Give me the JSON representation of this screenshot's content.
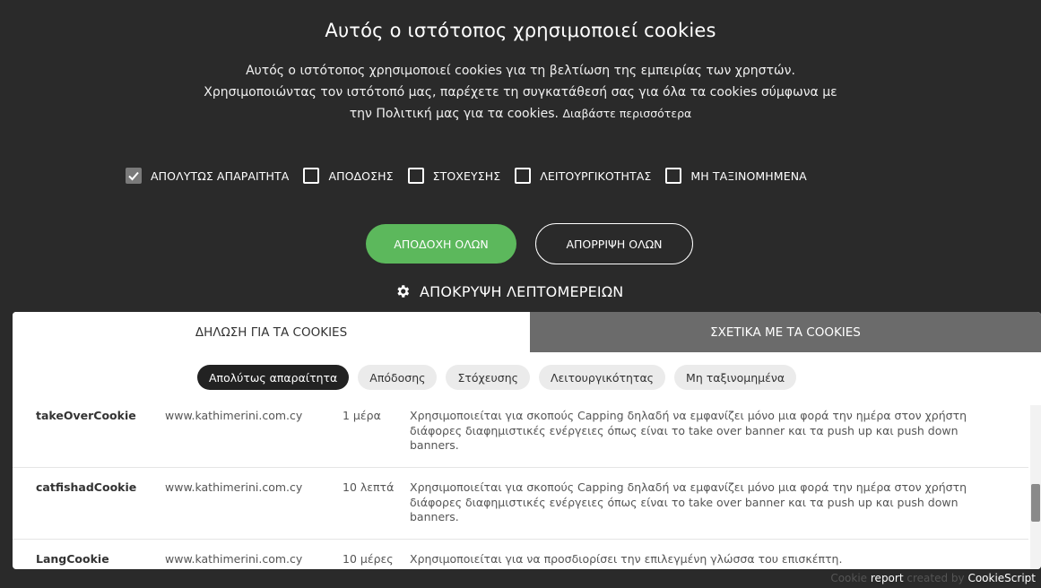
{
  "banner": {
    "title": "Αυτός ο ιστότοπος χρησιμοποιεί cookies",
    "desc_line1": "Αυτός ο ιστότοπος χρησιμοποιεί cookies για τη βελτίωση της εμπειρίας των χρηστών.",
    "desc_line2": "Χρησιμοποιώντας τον ιστότοπό μας, παρέχετε τη συγκατάθεσή σας για όλα τα cookies σύμφωνα με",
    "desc_line3": "την Πολιτική μας για τα cookies.",
    "read_more": "Διαβάστε περισσότερα"
  },
  "checkboxes": [
    {
      "label": "ΑΠΟΛΥΤΩΣ ΑΠΑΡΑΙΤΗΤΑ",
      "checked": true
    },
    {
      "label": "ΑΠΟΔΟΣΗΣ",
      "checked": false
    },
    {
      "label": "ΣΤΟΧΕΥΣΗΣ",
      "checked": false
    },
    {
      "label": "ΛΕΙΤΟΥΡΓΙΚΟΤΗΤΑΣ",
      "checked": false
    },
    {
      "label": "ΜΗ ΤΑΞΙΝΟΜΗΜΕΝΑ",
      "checked": false
    }
  ],
  "buttons": {
    "accept": "ΑΠΟΔΟΧΗ ΟΛΩΝ",
    "reject": "ΑΠΟΡΡΙΨΗ ΟΛΩΝ",
    "details_toggle": "ΑΠΟΚΡΥΨΗ ΛΕΠΤΟΜΕΡΕΙΩΝ"
  },
  "tabs": [
    {
      "label": "ΔΗΛΩΣΗ ΓΙΑ ΤΑ COOKIES",
      "active": true
    },
    {
      "label": "ΣΧΕΤΙΚΑ ΜΕ ΤΑ COOKIES",
      "active": false
    }
  ],
  "categories": [
    {
      "label": "Απολύτως απαραίτητα",
      "active": true
    },
    {
      "label": "Απόδοσης",
      "active": false
    },
    {
      "label": "Στόχευσης",
      "active": false
    },
    {
      "label": "Λειτουργικότητας",
      "active": false
    },
    {
      "label": "Μη ταξινομημένα",
      "active": false
    }
  ],
  "cookies": [
    {
      "name": "takeOverCookie",
      "host": "www.kathimerini.com.cy",
      "expiry": "1 μέρα",
      "description": "Χρησιμοποιείται για σκοπούς Capping δηλαδή να εμφανίζει μόνο μια φορά την ημέρα στον χρήστη διάφορες διαφημιστικές ενέργειες όπως είναι το take over banner και τα push up και push down banners."
    },
    {
      "name": "catfishadCookie",
      "host": "www.kathimerini.com.cy",
      "expiry": "10 λεπτά",
      "description": "Χρησιμοποιείται για σκοπούς Capping δηλαδή να εμφανίζει μόνο μια φορά την ημέρα στον χρήστη διάφορες διαφημιστικές ενέργειες όπως είναι το take over banner και τα push up και push down banners."
    },
    {
      "name": "LangCookie",
      "host": "www.kathimerini.com.cy",
      "expiry": "10 μέρες",
      "description": "Χρησιμοποιείται για να προσδιορίσει την επιλεγμένη γλώσσα του επισκέπτη."
    }
  ],
  "footer": {
    "part1": "Cookie",
    "part2": "report",
    "part3": "created by",
    "part4": "CookieScript"
  }
}
